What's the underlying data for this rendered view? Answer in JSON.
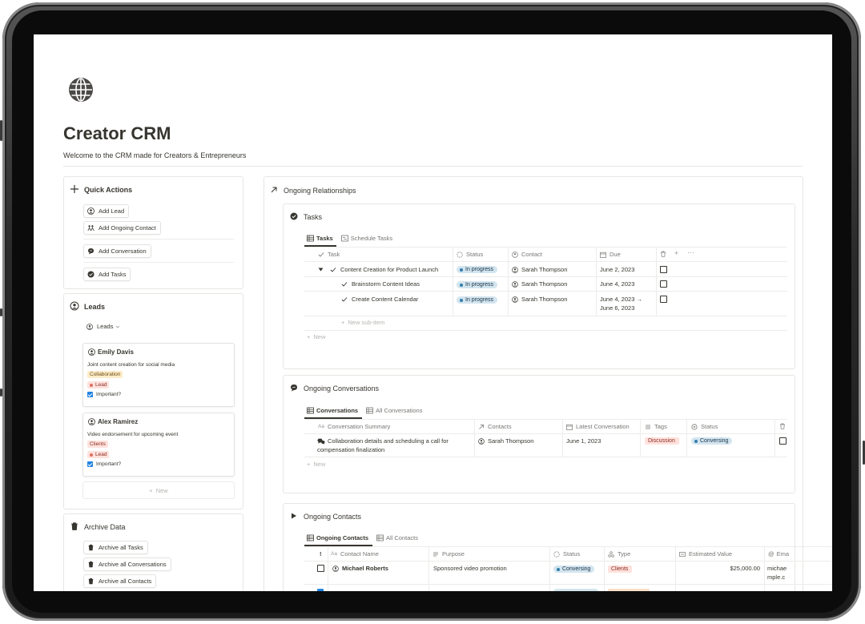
{
  "page": {
    "title": "Creator CRM",
    "subtitle": "Welcome to the CRM made for Creators & Entrepreneurs",
    "page_icon": "globe-icon"
  },
  "quick_actions": {
    "title": "Quick Actions",
    "buttons": [
      "Add Lead",
      "Add Ongoing Contact",
      "Add Conversation",
      "Add Tasks"
    ]
  },
  "leads": {
    "title": "Leads",
    "view_label": "Leads",
    "cards": [
      {
        "name": "Emily Davis",
        "desc": "Joint content creation for social media",
        "tag": "Collaboration",
        "status": "Lead",
        "important": "Important?"
      },
      {
        "name": "Alex Ramirez",
        "desc": "Video endorsement for upcoming event",
        "tag": "Clients",
        "status": "Lead",
        "important": "Important?"
      }
    ],
    "new_label": "New"
  },
  "archive": {
    "title": "Archive Data",
    "buttons": [
      "Archive all Tasks",
      "Archive all Conversations",
      "Archive all Contacts"
    ]
  },
  "ongoing": {
    "title": "Ongoing Relationships",
    "tasks": {
      "title": "Tasks",
      "tabs": [
        "Tasks",
        "Schedule Tasks"
      ],
      "headers": [
        "Task",
        "Status",
        "Contact",
        "Due"
      ],
      "rows": [
        {
          "task": "Content Creation for Product Launch",
          "status": "In progress",
          "contact": "Sarah Thompson",
          "due": "June 2, 2023",
          "due2": ""
        },
        {
          "task": "Brainstorm Content Ideas",
          "status": "In progress",
          "contact": "Sarah Thompson",
          "due": "June 4, 2023",
          "due2": ""
        },
        {
          "task": "Create Content Calendar",
          "status": "In progress",
          "contact": "Sarah Thompson",
          "due": "June 4, 2023 →",
          "due2": "June 6, 2023"
        }
      ],
      "new_sub_item": "New sub-item",
      "new_label": "New"
    },
    "conversations": {
      "title": "Ongoing Conversations",
      "tabs": [
        "Conversations",
        "All Conversations"
      ],
      "headers": [
        "Conversation Summary",
        "Contacts",
        "Latest Conversation",
        "Tags",
        "Status"
      ],
      "rows": [
        {
          "summary_1": "Collaboration details and scheduling a call for",
          "summary_2": "compensation finalization",
          "contact": "Sarah Thompson",
          "latest": "June 1, 2023",
          "tag": "Discussion",
          "status": "Conversing"
        }
      ],
      "new_label": "New"
    },
    "contacts": {
      "title": "Ongoing Contacts",
      "tabs": [
        "Ongoing Contacts",
        "All Contacts"
      ],
      "headers": [
        "!",
        "Contact Name",
        "Purpose",
        "Status",
        "Type",
        "Estimated Value",
        "Ema"
      ],
      "rows": [
        {
          "name": "Michael Roberts",
          "purpose": "Sponsored video promotion",
          "status": "Conversing",
          "type": "Clients",
          "value": "$25,000.00",
          "email_1": "michae",
          "email_2": "mple.c"
        }
      ]
    }
  },
  "colors": {
    "text": "#37352f",
    "muted": "#787774",
    "blue_pill": "#d3e5ef",
    "red_tag": "#ffe2dd",
    "yellow_tag": "#fdecc8",
    "checkbox_blue": "#2383e2"
  }
}
